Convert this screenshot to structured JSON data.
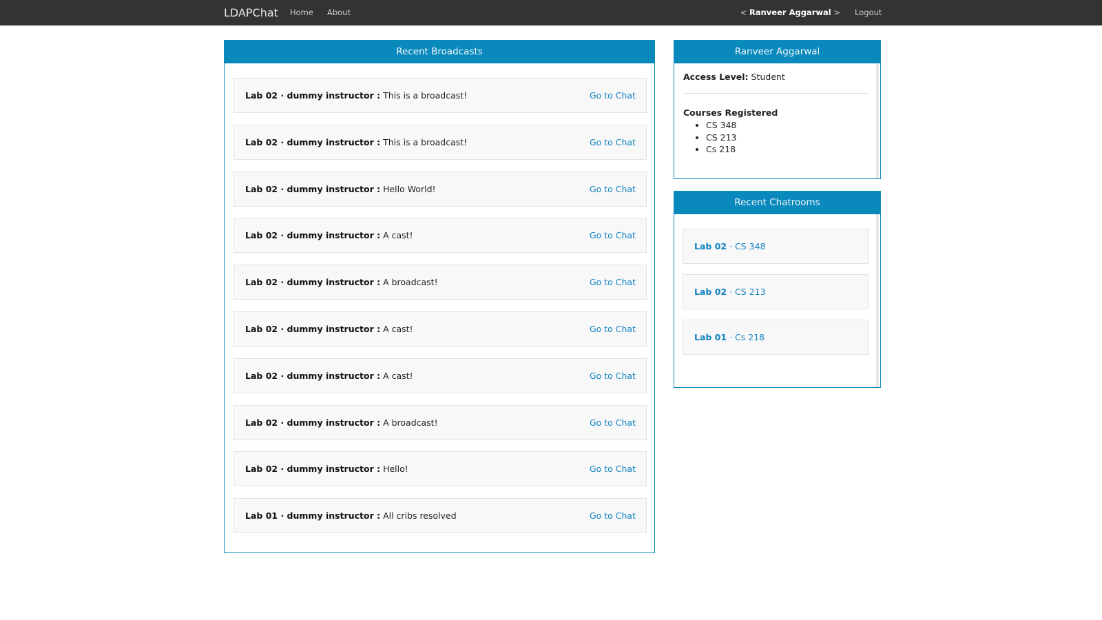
{
  "navbar": {
    "brand": "LDAPChat",
    "links": [
      "Home",
      "About"
    ],
    "user_prefix": "< ",
    "user_name": "Ranveer Aggarwal",
    "user_suffix": " >",
    "logout": "Logout"
  },
  "broadcasts": {
    "title": "Recent Broadcasts",
    "link_label": "Go to Chat",
    "items": [
      {
        "source": "Lab 02 · dummy instructor :",
        "message": " This is a broadcast!"
      },
      {
        "source": "Lab 02 · dummy instructor :",
        "message": " This is a broadcast!"
      },
      {
        "source": "Lab 02 · dummy instructor :",
        "message": " Hello World!"
      },
      {
        "source": "Lab 02 · dummy instructor :",
        "message": " A cast!"
      },
      {
        "source": "Lab 02 · dummy instructor :",
        "message": " A broadcast!"
      },
      {
        "source": "Lab 02 · dummy instructor :",
        "message": " A cast!"
      },
      {
        "source": "Lab 02 · dummy instructor :",
        "message": " A cast!"
      },
      {
        "source": "Lab 02 · dummy instructor :",
        "message": " A broadcast!"
      },
      {
        "source": "Lab 02 · dummy instructor :",
        "message": " Hello!"
      },
      {
        "source": "Lab 01 · dummy instructor :",
        "message": " All cribs resolved"
      }
    ]
  },
  "profile": {
    "name": "Ranveer Aggarwal",
    "access_label": "Access Level:",
    "access_value": " Student",
    "courses_label": "Courses Registered",
    "courses": [
      "CS 348",
      "CS 213",
      "Cs 218"
    ]
  },
  "chatrooms": {
    "title": "Recent Chatrooms",
    "items": [
      {
        "lab": "Lab 02",
        "course": " · CS 348"
      },
      {
        "lab": "Lab 02",
        "course": " · CS 213"
      },
      {
        "lab": "Lab 01",
        "course": " · Cs 218"
      }
    ]
  }
}
